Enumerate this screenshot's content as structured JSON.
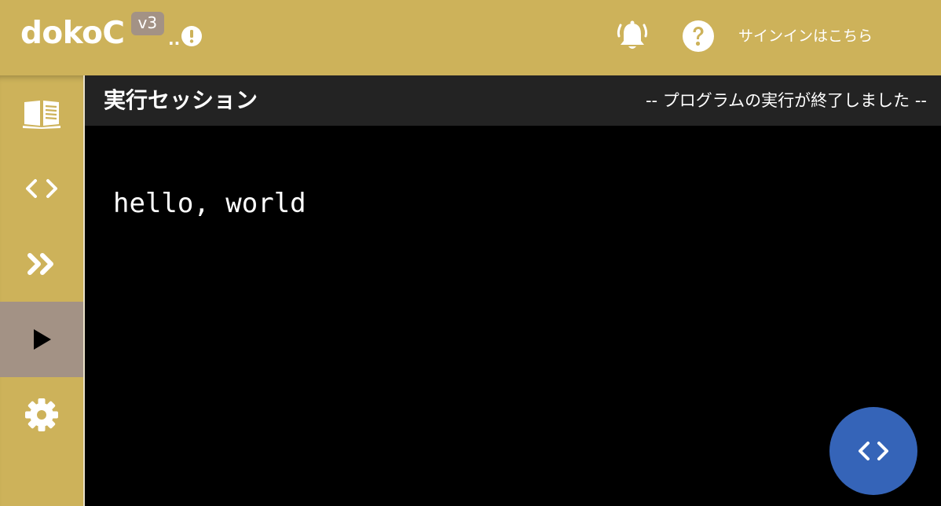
{
  "header": {
    "app_title": "dokoC",
    "version": "v3",
    "dots": "..",
    "signin_label": "サインインはこちら",
    "background": "#cdb25a"
  },
  "sidebar": {
    "items": [
      {
        "icon": "book-icon",
        "active": false
      },
      {
        "icon": "code-icon",
        "active": false
      },
      {
        "icon": "double-chevron-right-icon",
        "active": false
      },
      {
        "icon": "play-icon",
        "active": true
      },
      {
        "icon": "gear-icon",
        "active": false
      }
    ],
    "active_color": "#a39285"
  },
  "session": {
    "title": "実行セッション",
    "status": "-- プログラムの実行が終了しました --",
    "output": "hello, world"
  },
  "fab": {
    "icon": "code-icon",
    "color": "#3564b8"
  }
}
